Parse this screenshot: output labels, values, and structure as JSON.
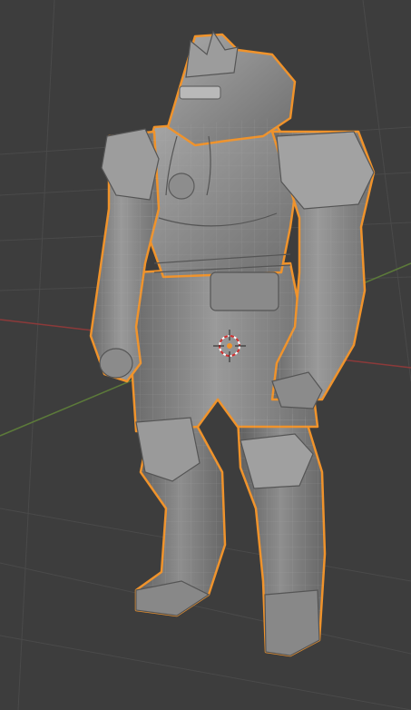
{
  "viewport": {
    "mode": "3d-viewport",
    "shading": "solid",
    "overlay": "wireframe",
    "background_color": "#3d3d3d",
    "grid_color": "#4a4a4a",
    "x_axis_color": "#8c3a3a",
    "y_axis_color": "#5c7a3a",
    "selection_outline_color": "#f0932b",
    "mesh_color": "#8a8a8a"
  },
  "scene": {
    "selected_object": "armored-character-mesh",
    "cursor": "3d-cursor"
  }
}
